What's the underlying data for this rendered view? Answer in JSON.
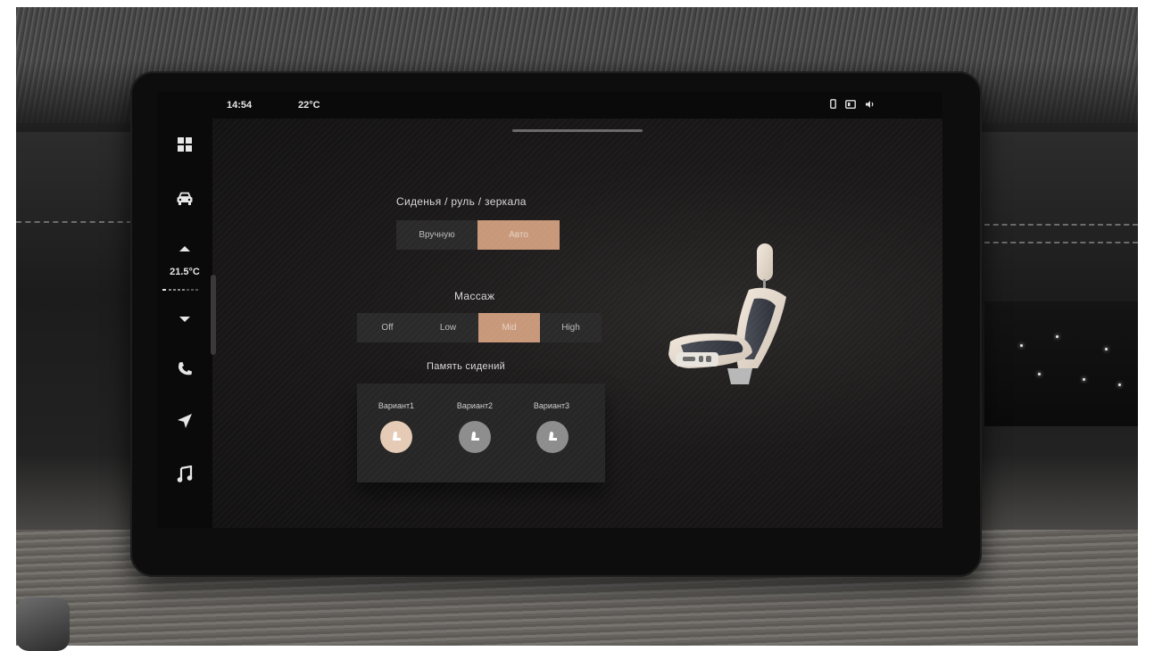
{
  "status_bar": {
    "time": "14:54",
    "outside_temp": "22°C",
    "icons": [
      "phone-status-icon",
      "battery-icon",
      "volume-icon"
    ]
  },
  "sidebar": {
    "items": [
      {
        "name": "apps-grid-icon"
      },
      {
        "name": "car-icon"
      },
      {
        "name": "temp-up-icon"
      },
      {
        "name": "temp-down-icon"
      },
      {
        "name": "phone-icon"
      },
      {
        "name": "navigation-icon"
      },
      {
        "name": "music-icon"
      }
    ],
    "cabin_temp": "21.5°C"
  },
  "seat_steering_mirrors": {
    "title": "Сиденья / руль / зеркала",
    "options": [
      "Вручную",
      "Авто"
    ],
    "selected": "Авто"
  },
  "massage": {
    "title": "Массаж",
    "options": [
      "Off",
      "Low",
      "Mid",
      "High"
    ],
    "selected": "Mid"
  },
  "seat_memory": {
    "title": "Память сидений",
    "variants": [
      {
        "label": "Вариант1",
        "active": true
      },
      {
        "label": "Вариант2",
        "active": false
      },
      {
        "label": "Вариант3",
        "active": false
      }
    ]
  },
  "colors": {
    "accent": "#c8987a",
    "memory_active": "#e5cbb5",
    "memory_inactive": "#8d8d8d",
    "sidebar_bg": "#0a0a0a"
  }
}
